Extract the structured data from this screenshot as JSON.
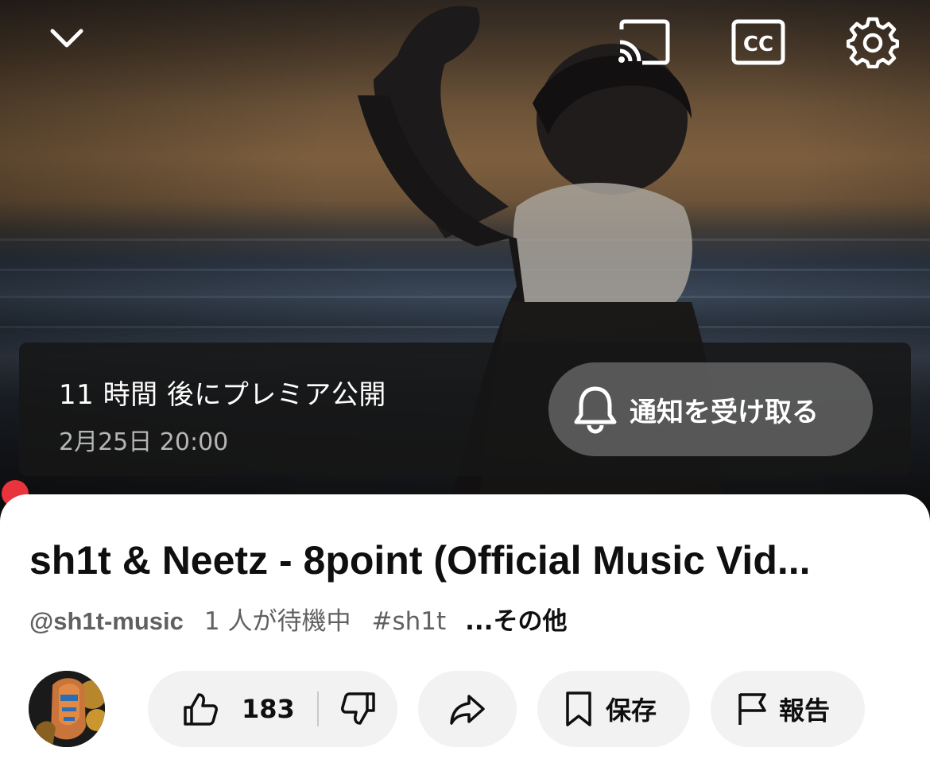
{
  "player": {
    "icons": {
      "collapse": "chevron-down-icon",
      "cast": "cast-icon",
      "captions": "closed-captions-icon",
      "settings": "gear-icon"
    },
    "premiere": {
      "title": "11 時間 後にプレミア公開",
      "date": "2月25日 20:00",
      "notify_label": "通知を受け取る",
      "notify_icon": "bell-icon"
    },
    "progress_color": "#e9333d"
  },
  "video": {
    "title": "sh1t & Neetz - 8point (Official Music Vid...",
    "channel_handle": "@sh1t-music",
    "waiting": "1 人が待機中",
    "hashtag": "#sh1t",
    "more": "...その他"
  },
  "actions": {
    "like_count": "183",
    "like_icon": "thumbs-up-icon",
    "dislike_icon": "thumbs-down-icon",
    "share_icon": "share-arrow-icon",
    "save_label": "保存",
    "save_icon": "bookmark-icon",
    "report_label": "報告",
    "report_icon": "flag-icon"
  }
}
